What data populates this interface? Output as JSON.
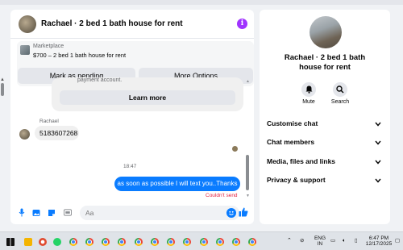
{
  "header": {
    "title": "Rachael · 2 bed 1 bath house for rent"
  },
  "listing": {
    "label": "Marketplace",
    "price_line": "$700 – 2 bed 1 bath house for rent",
    "pending_button": "Mark as pending",
    "options_button": "More Options"
  },
  "system_message": {
    "text": "payment account.",
    "learn_more": "Learn more"
  },
  "messages": {
    "sender_name": "Rachael",
    "received_text": "5183607268",
    "timestamp": "18:47",
    "sent_text": "as soon as possible I will text you..Thanks",
    "error_text": "Couldn't send"
  },
  "composer": {
    "placeholder": "Aa"
  },
  "info_panel": {
    "name": "Rachael · 2 bed 1 bath house for rent",
    "actions": [
      {
        "label": "Mute",
        "icon": "bell-icon"
      },
      {
        "label": "Search",
        "icon": "search-icon"
      }
    ],
    "sections": [
      {
        "label": "Customise chat"
      },
      {
        "label": "Chat members"
      },
      {
        "label": "Media, files and links"
      },
      {
        "label": "Privacy & support"
      }
    ]
  },
  "taskbar": {
    "language_top": "ENG",
    "language_bottom": "IN",
    "time": "6:47 PM",
    "date": "12/17/2025"
  },
  "colors": {
    "accent": "#0a7cff",
    "error": "#e41e3f",
    "info_icon": "#a033ff",
    "background": "#f0f2f5"
  }
}
